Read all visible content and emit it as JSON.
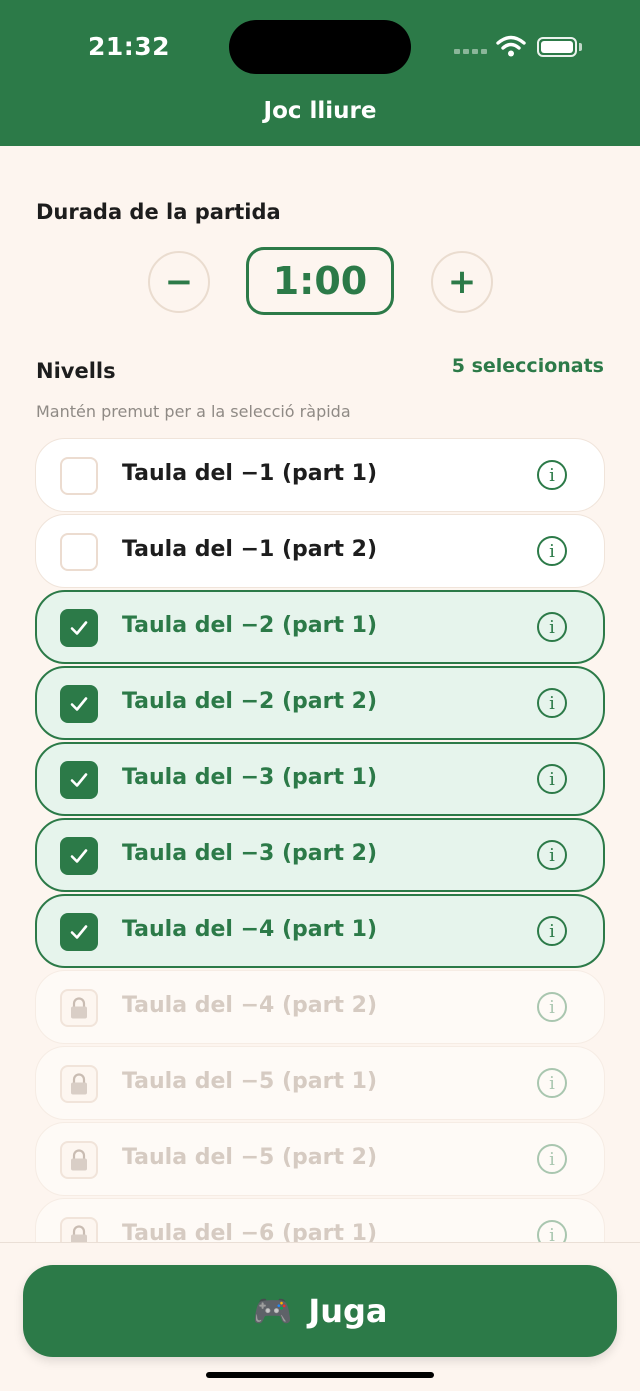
{
  "status_bar": {
    "time": "21:32"
  },
  "header": {
    "title": "Joc lliure"
  },
  "duration": {
    "label": "Durada de la partida",
    "value": "1:00",
    "decrement_label": "−",
    "increment_label": "+"
  },
  "levels": {
    "label": "Nivells",
    "selected_count": "5 seleccionats",
    "hint": "Mantén premut per a la selecció ràpida",
    "items": [
      {
        "label": "Taula del −1 (part 1)",
        "state": "unchecked"
      },
      {
        "label": "Taula del −1 (part 2)",
        "state": "unchecked"
      },
      {
        "label": "Taula del −2 (part 1)",
        "state": "checked"
      },
      {
        "label": "Taula del −2 (part 2)",
        "state": "checked"
      },
      {
        "label": "Taula del −3 (part 1)",
        "state": "checked"
      },
      {
        "label": "Taula del −3 (part 2)",
        "state": "checked"
      },
      {
        "label": "Taula del −4 (part 1)",
        "state": "checked"
      },
      {
        "label": "Taula del −4 (part 2)",
        "state": "locked"
      },
      {
        "label": "Taula del −5 (part 1)",
        "state": "locked"
      },
      {
        "label": "Taula del −5 (part 2)",
        "state": "locked"
      },
      {
        "label": "Taula del −6 (part 1)",
        "state": "locked"
      }
    ]
  },
  "play_button": {
    "label": "Juga",
    "icon": "gamepad-icon",
    "emoji": "🎮"
  },
  "colors": {
    "primary": "#2c7a48",
    "background": "#fdf5ef",
    "selected_row": "#e6f4ec"
  }
}
